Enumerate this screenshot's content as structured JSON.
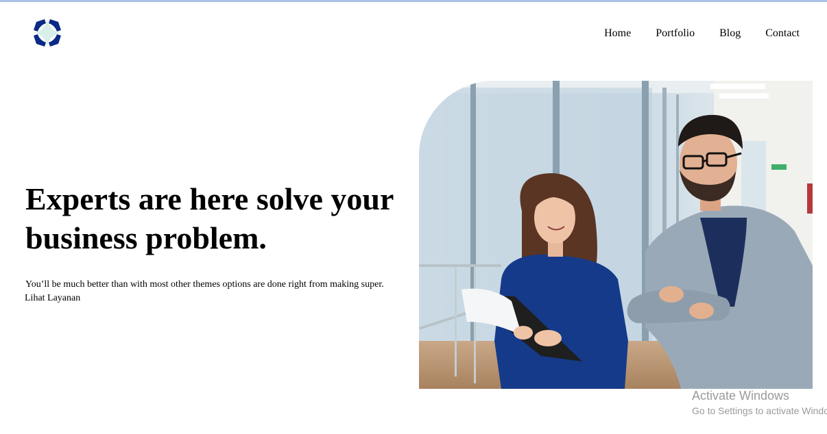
{
  "brand": {
    "logo_icon": "four-petal-logo-icon",
    "colors": {
      "primary": "#0b2a86",
      "accent": "#d9efe9"
    }
  },
  "nav": {
    "items": [
      {
        "label": "Home"
      },
      {
        "label": "Portfolio"
      },
      {
        "label": "Blog"
      },
      {
        "label": "Contact"
      }
    ]
  },
  "hero": {
    "title_line1": "Experts are here solve your",
    "title_line2": "business problem.",
    "description": "You’ll be much better than with most other themes options are done right from making super.",
    "link_label": "Lihat Layanan",
    "image_alt": "Two business colleagues discussing a document in an office"
  },
  "watermark": {
    "title": "Activate Windows",
    "subtitle": "Go to Settings to activate Windows."
  }
}
